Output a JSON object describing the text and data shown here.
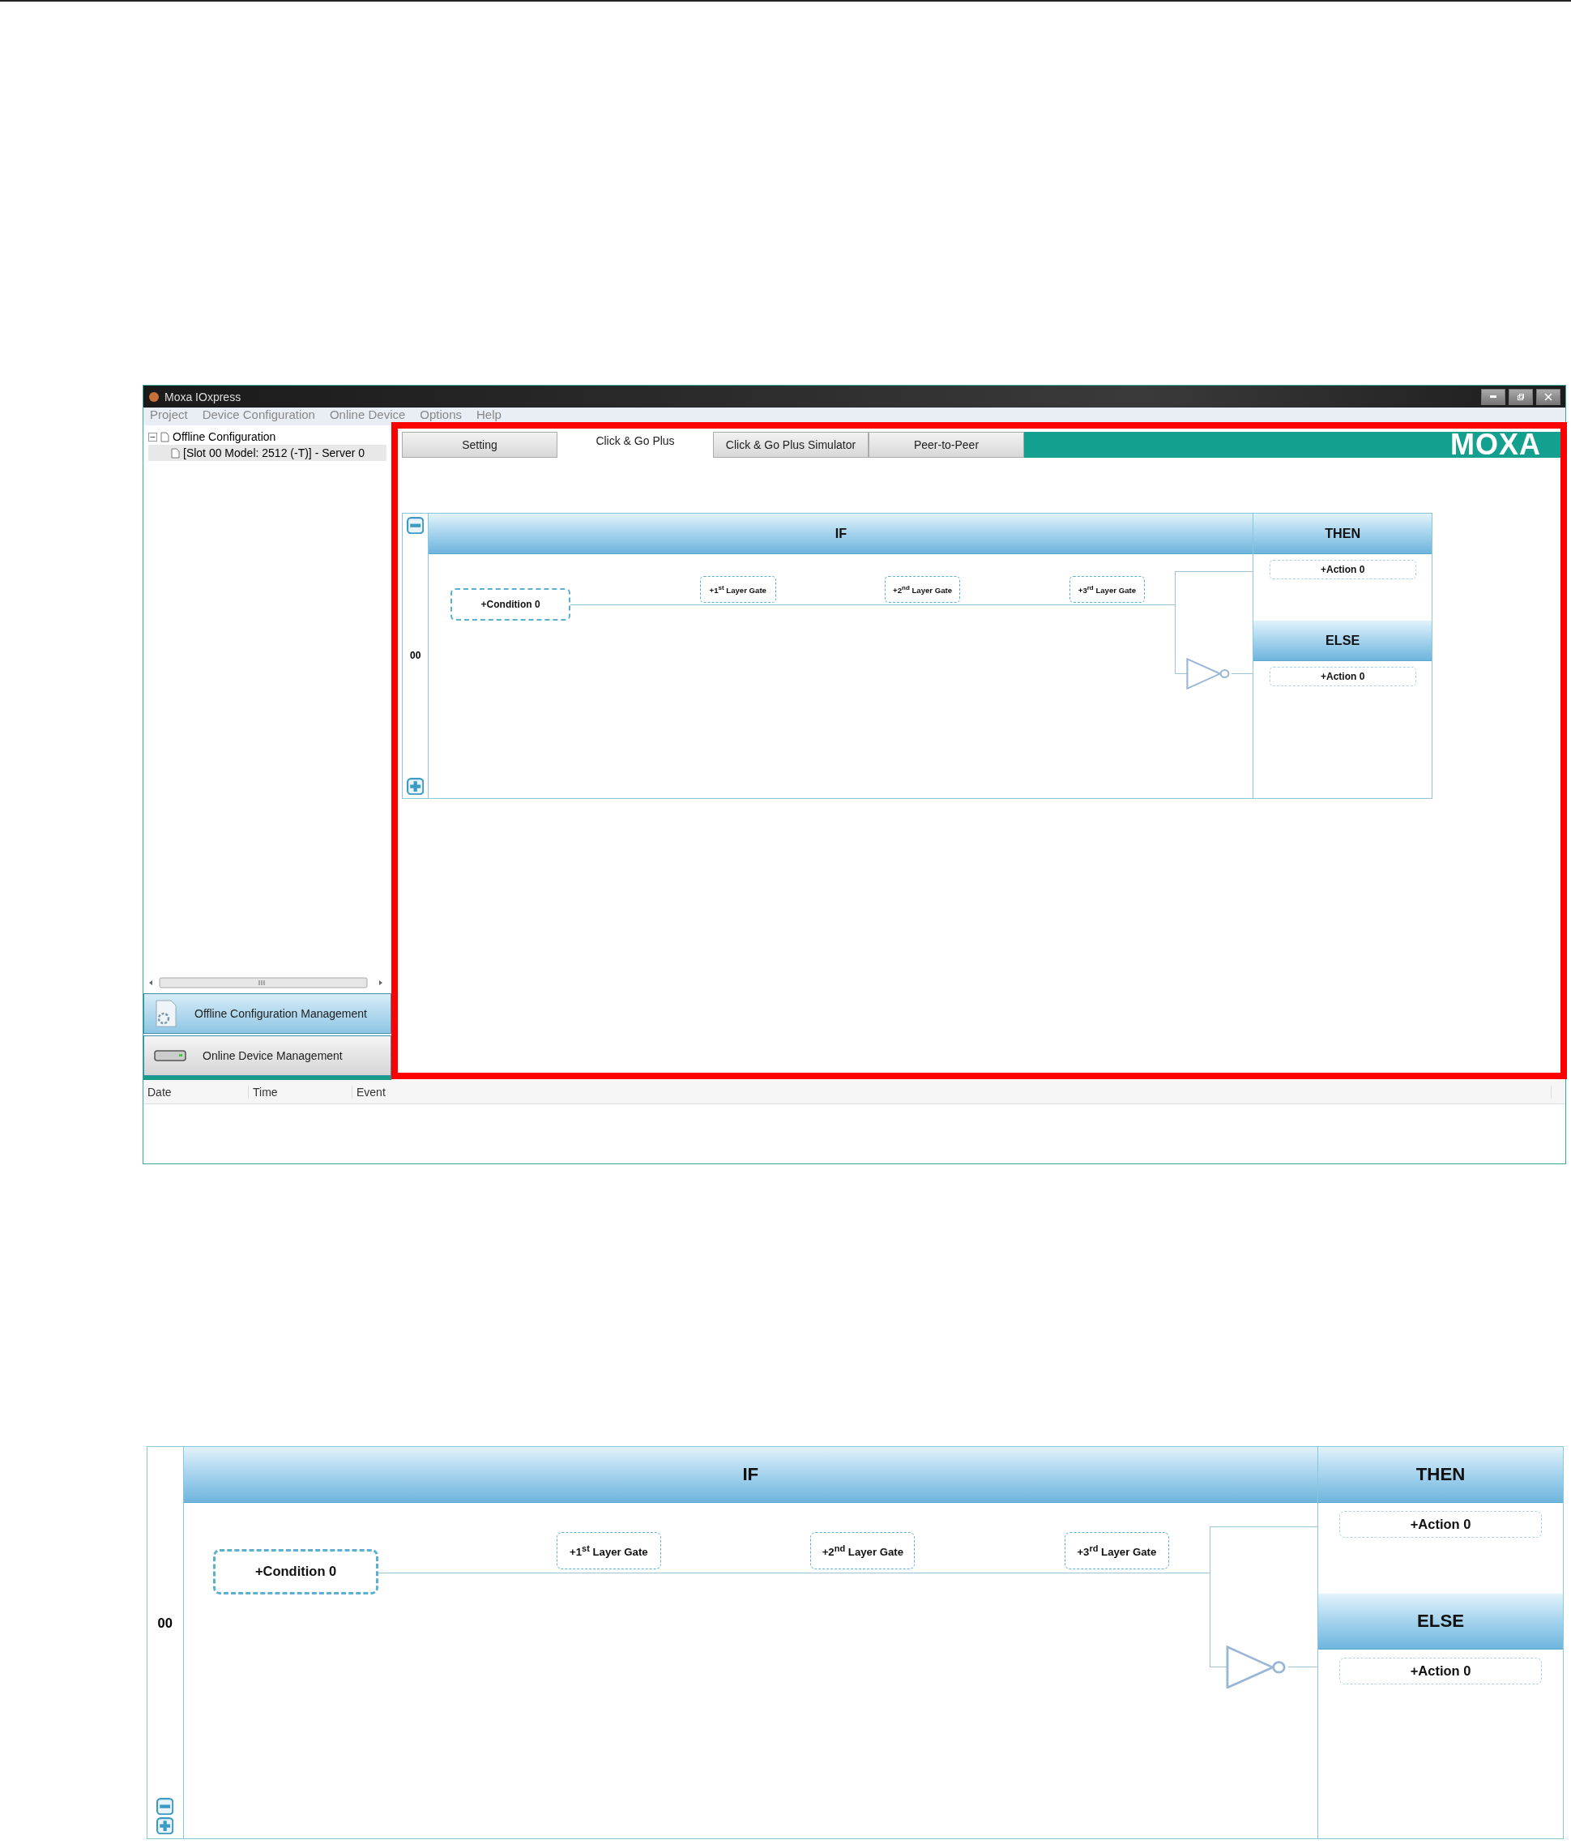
{
  "window": {
    "title": "Moxa IOxpress"
  },
  "menu": [
    "Project",
    "Device Configuration",
    "Online Device",
    "Options",
    "Help"
  ],
  "tree": [
    {
      "label": "Offline Configuration",
      "expanded": true,
      "children": [
        {
          "label": "[Slot 00 Model: 2512 (-T)] - Server 0",
          "selected": true
        }
      ]
    }
  ],
  "nav": [
    {
      "label": "Offline Configuration Management",
      "selected": true
    },
    {
      "label": "Online Device Management",
      "selected": false
    }
  ],
  "tabs": [
    {
      "label": "Setting",
      "selected": false
    },
    {
      "label": "Click & Go Plus",
      "selected": true
    },
    {
      "label": "Click & Go Plus Simulator",
      "selected": false
    },
    {
      "label": "Peer-to-Peer",
      "selected": false
    }
  ],
  "brand": "MOXA",
  "log_columns": [
    "Date",
    "Time",
    "Event"
  ],
  "diagrams": [
    {
      "kind": "split",
      "if_label": "IF",
      "then_label": "THEN",
      "else_label": "ELSE",
      "row": "00",
      "condition": "+Condition 0",
      "gates": [
        "+1$^{st}$ Layer Gate",
        "+2$^{nd}$ Layer Gate",
        "+3$^{rd}$ Layer Gate"
      ],
      "then_action": "+Action 0",
      "else_action": "+Action 0"
    },
    {
      "kind": "stacked",
      "if_label": "IF",
      "then_label": "THEN",
      "else_label": "ELSE",
      "row": "00",
      "condition": "+Condition 0",
      "gates": [
        "+1$^{st}$ Layer Gate",
        "+2$^{nd}$ Layer Gate",
        "+3$^{rd}$ Layer Gate"
      ],
      "then_action": "+Action 0",
      "else_action": "+Action 0"
    }
  ]
}
